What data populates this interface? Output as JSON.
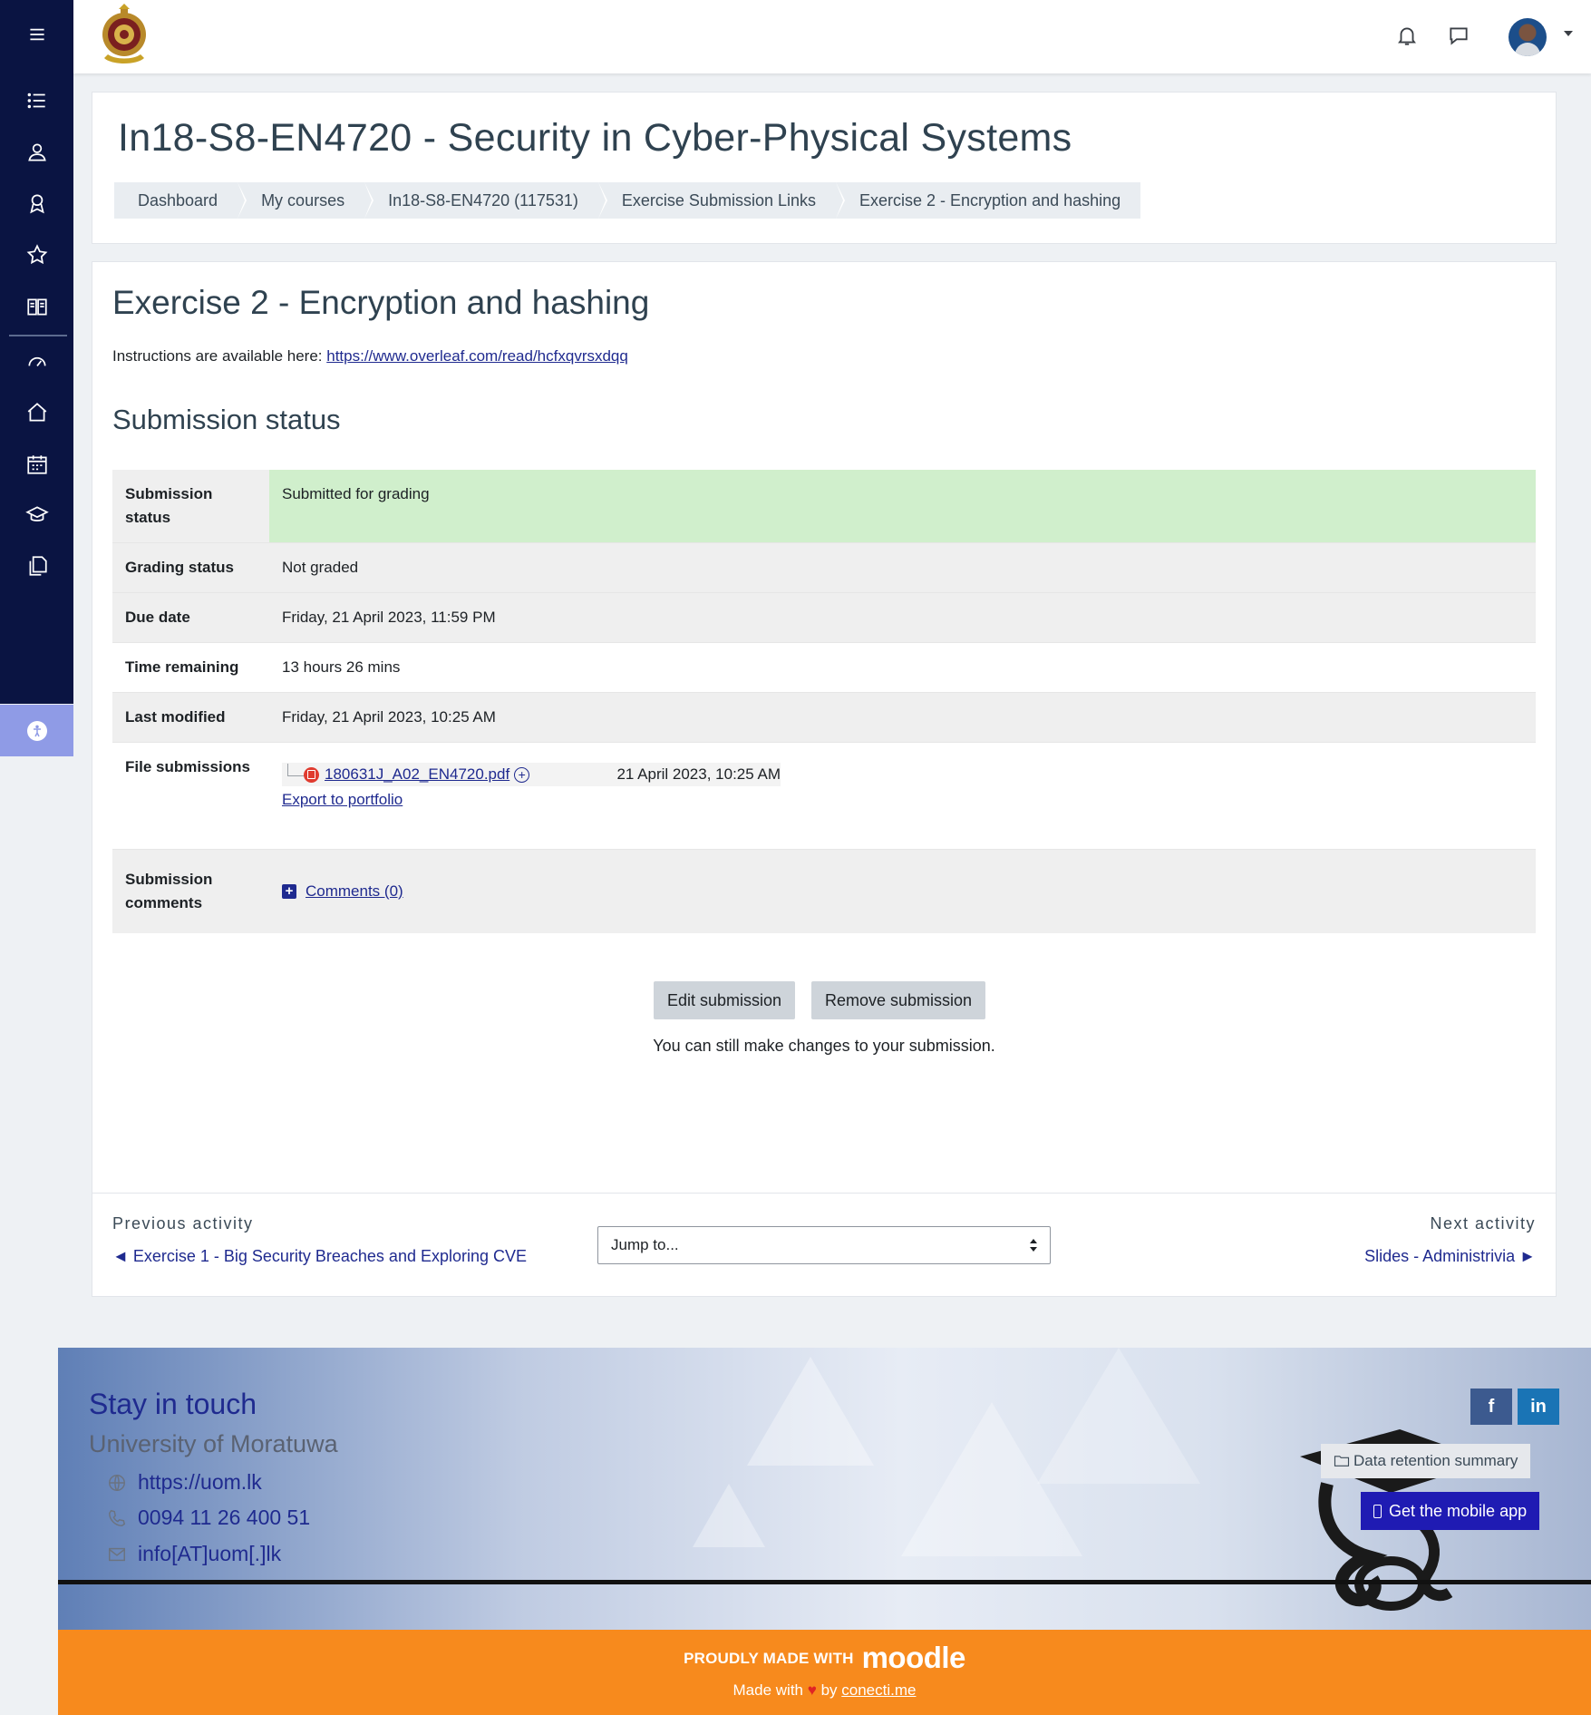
{
  "topbar": {
    "menu_icon": "hamburger-icon",
    "icons": [
      "bell-icon",
      "chat-icon",
      "avatar",
      "chevron-down-icon"
    ]
  },
  "rail": {
    "icons": [
      "list-icon",
      "user-badge-icon",
      "award-icon",
      "star-icon",
      "book-icon",
      "dashboard-icon",
      "home-icon",
      "calendar-icon",
      "graduation-cap-icon",
      "files-icon",
      "accessibility-icon"
    ]
  },
  "header": {
    "course_title": "In18-S8-EN4720 - Security in Cyber-Physical Systems",
    "breadcrumb": [
      "Dashboard",
      "My courses",
      "In18-S8-EN4720 (117531)",
      "Exercise Submission Links",
      "Exercise 2 - Encryption and hashing"
    ]
  },
  "activity": {
    "title": "Exercise 2 - Encryption and hashing",
    "intro_prefix": "Instructions are available here: ",
    "intro_link": "https://www.overleaf.com/read/hcfxqvrsxdqq"
  },
  "submission": {
    "section_title": "Submission status",
    "rows": [
      {
        "label": "Submission status",
        "value": "Submitted for grading"
      },
      {
        "label": "Grading status",
        "value": "Not graded"
      },
      {
        "label": "Due date",
        "value": "Friday, 21 April 2023, 11:59 PM"
      },
      {
        "label": "Time remaining",
        "value": "13 hours 26 mins"
      },
      {
        "label": "Last modified",
        "value": "Friday, 21 April 2023, 10:25 AM"
      },
      {
        "label": "File submissions",
        "value": ""
      },
      {
        "label": "Submission comments",
        "value": ""
      }
    ],
    "file": {
      "name": "180631J_A02_EN4720.pdf",
      "date": "21 April 2023, 10:25 AM",
      "export_label": "Export to portfolio"
    },
    "comments_label": "Comments (0)"
  },
  "actions": {
    "edit_label": "Edit submission",
    "remove_label": "Remove submission",
    "note": "You can still make changes to your submission."
  },
  "activity_nav": {
    "prev_label": "Previous activity",
    "prev_link": "◄ Exercise 1 - Big Security Breaches and Exploring CVE",
    "jump_placeholder": "Jump to...",
    "next_label": "Next activity",
    "next_link": "Slides - Administrivia ►"
  },
  "footer": {
    "stay_title": "Stay in touch",
    "university": "University of Moratuwa",
    "website": "https://uom.lk",
    "phone": "0094 11 26 400 51",
    "email": "info[AT]uom[.]lk",
    "social": {
      "facebook": "f",
      "linkedin": "in"
    },
    "data_retention": "Data retention summary",
    "mobile_app": "Get the mobile app",
    "proudly": "PROUDLY MADE WITH",
    "moodle": "moodle",
    "made_prefix": "Made with",
    "made_by": "by",
    "made_link": "conecti.me"
  },
  "colors": {
    "sidebar": "#0a1442",
    "accent": "#1f2a8f",
    "success_bg": "#d0efcc",
    "footer_orange": "#f78a1d"
  }
}
